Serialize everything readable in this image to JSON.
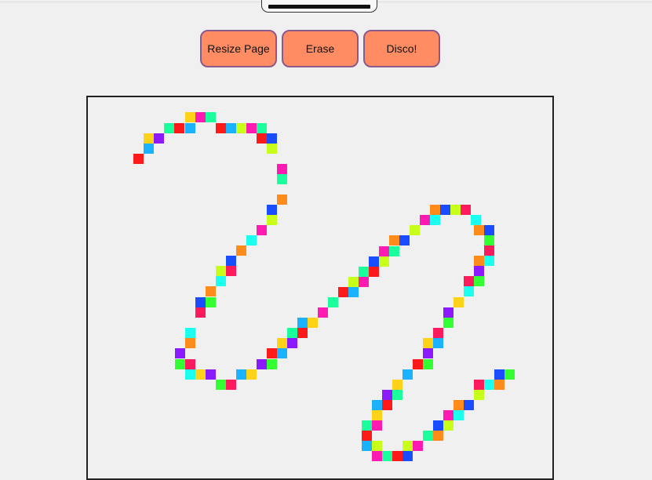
{
  "toolbar": {
    "resize_label": "Resize Page",
    "erase_label": "Erase",
    "disco_label": "Disco!"
  },
  "colors": {
    "button_bg": "#ff8c63",
    "button_border": "#8a5a8c",
    "canvas_border": "#222222",
    "background": "#f0f0f0"
  }
}
